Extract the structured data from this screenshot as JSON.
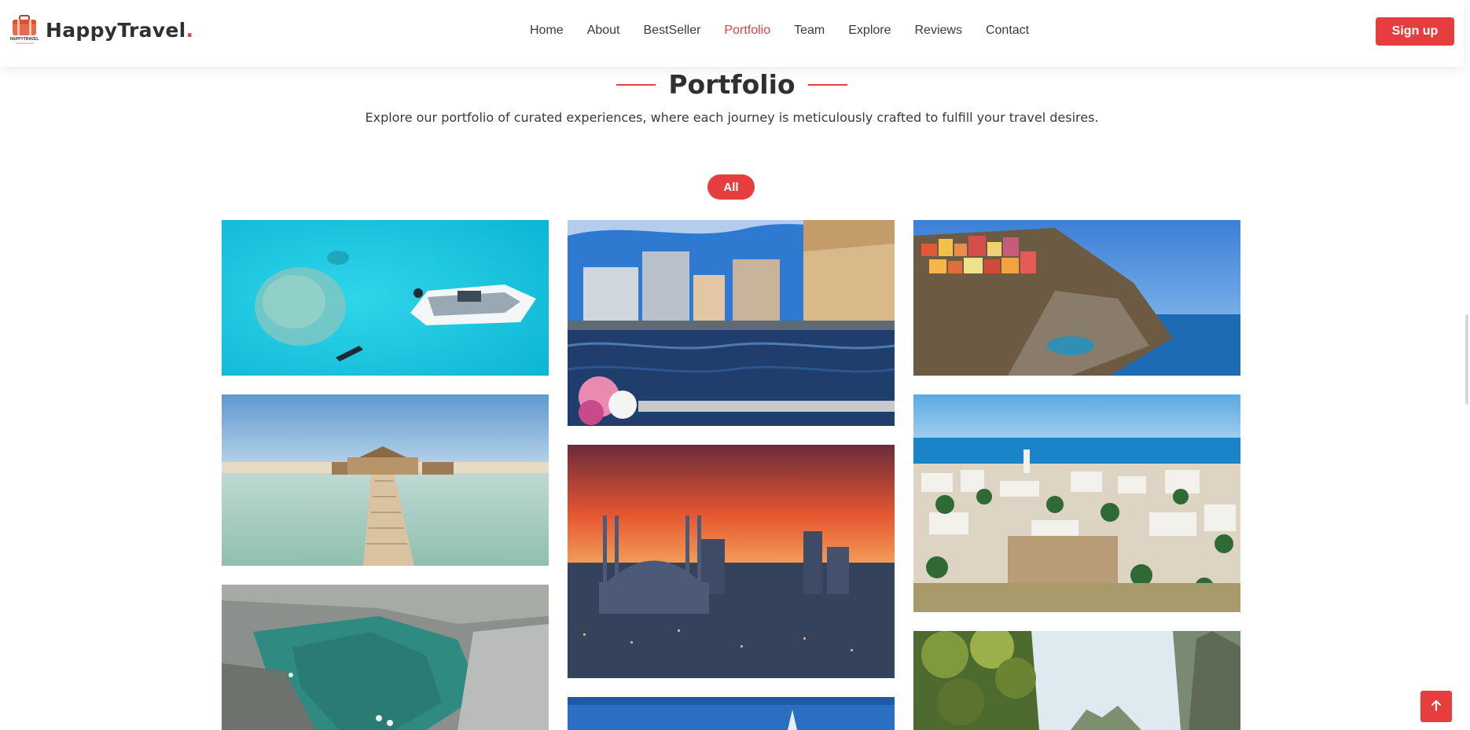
{
  "header": {
    "brand_name": "HappyTravel",
    "brand_dot": ".",
    "logo_text": "HAPPYTRAVEL",
    "logo_tagline": "explore the world",
    "nav": [
      {
        "label": "Home"
      },
      {
        "label": "About"
      },
      {
        "label": "BestSeller"
      },
      {
        "label": "Portfolio",
        "active": true
      },
      {
        "label": "Team"
      },
      {
        "label": "Explore"
      },
      {
        "label": "Reviews"
      },
      {
        "label": "Contact"
      }
    ],
    "signup_label": "Sign up"
  },
  "portfolio": {
    "title": "Portfolio",
    "subtitle": "Explore our portfolio of curated experiences, where each journey is meticulously crafted to fulfill your travel desires.",
    "filter_label": "All",
    "images": [
      {
        "name": "turquoise-sea-boat"
      },
      {
        "name": "harbor-city-canal"
      },
      {
        "name": "colorful-cliff-village"
      },
      {
        "name": "beach-hut-pier"
      },
      {
        "name": "sunset-mosque-city"
      },
      {
        "name": "white-town-seaside"
      },
      {
        "name": "green-lake-canyon"
      },
      {
        "name": "blue-sky-tower"
      },
      {
        "name": "tropical-jungle-cliffs"
      }
    ]
  },
  "colors": {
    "accent": "#e63e3e",
    "text": "#2f3031"
  },
  "icons": {
    "scroll_top": "arrow-up-icon",
    "logo": "suitcase-icon"
  }
}
